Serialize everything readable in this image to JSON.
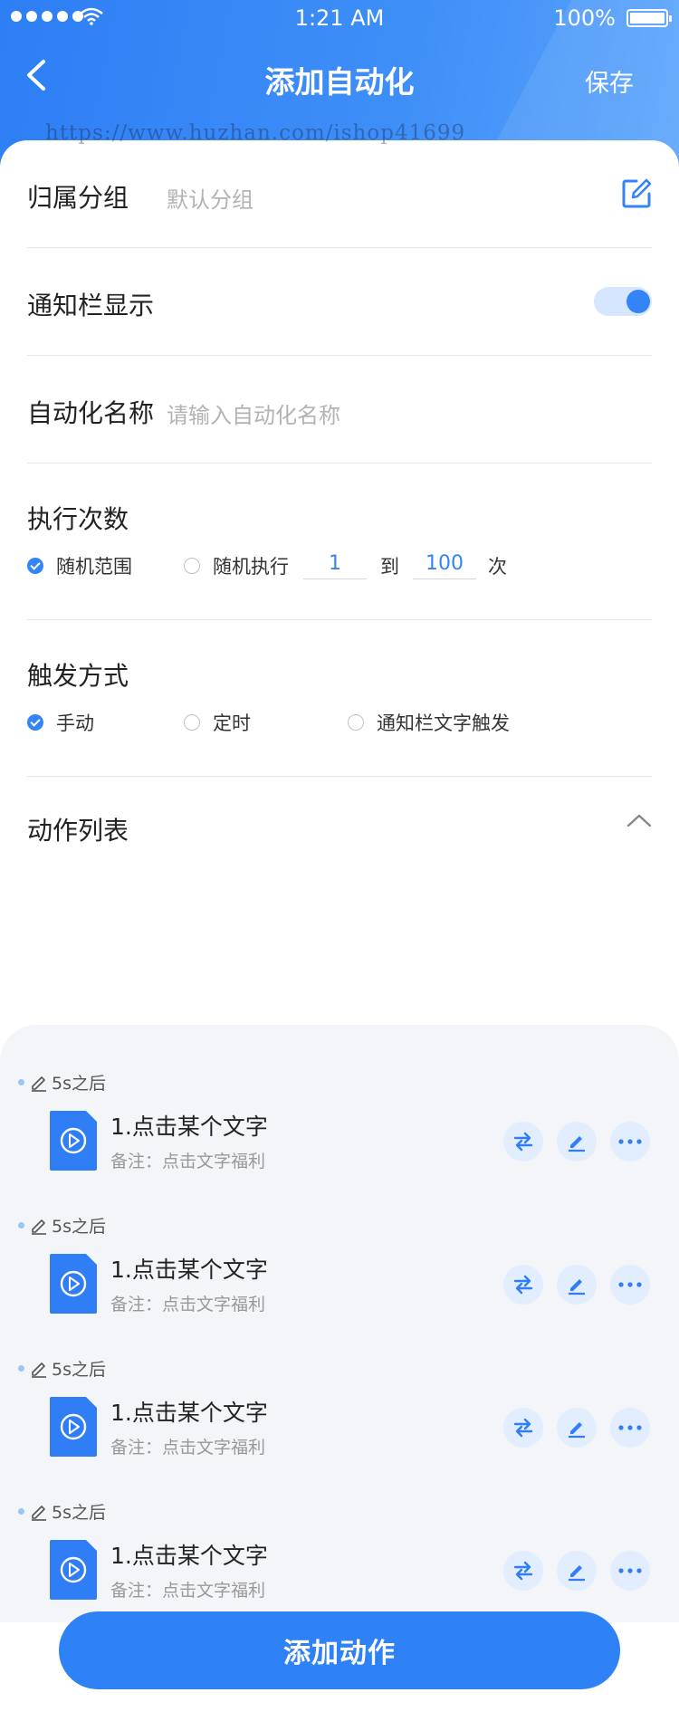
{
  "status_bar": {
    "time": "1:21 AM",
    "battery": "100%"
  },
  "nav": {
    "title": "添加自动化",
    "save_label": "保存"
  },
  "watermark": "https://www.huzhan.com/ishop41699",
  "form": {
    "group": {
      "label": "归属分组",
      "value": "默认分组"
    },
    "notify": {
      "label": "通知栏显示",
      "enabled": true
    },
    "name": {
      "label": "自动化名称",
      "placeholder": "请输入自动化名称"
    },
    "exec": {
      "label": "执行次数",
      "options": [
        {
          "label": "随机范围",
          "checked": true
        },
        {
          "label": "随机执行",
          "checked": false
        }
      ],
      "from": "1",
      "to_label": "到",
      "to": "100",
      "unit": "次"
    },
    "trigger": {
      "label": "触发方式",
      "options": [
        {
          "label": "手动",
          "checked": true
        },
        {
          "label": "定时",
          "checked": false
        },
        {
          "label": "通知栏文字触发",
          "checked": false
        }
      ]
    },
    "actions_label": "动作列表"
  },
  "actions": [
    {
      "delay": "5s之后",
      "title": "1.点击某个文字",
      "note": "备注：点击文字福利"
    },
    {
      "delay": "5s之后",
      "title": "1.点击某个文字",
      "note": "备注：点击文字福利"
    },
    {
      "delay": "5s之后",
      "title": "1.点击某个文字",
      "note": "备注：点击文字福利"
    },
    {
      "delay": "5s之后",
      "title": "1.点击某个文字",
      "note": "备注：点击文字福利"
    }
  ],
  "add_button": "添加动作",
  "colors": {
    "primary": "#2f82f6",
    "light_blue": "#e2edfd",
    "bg": "#f4f5f9"
  },
  "icons": [
    "back-arrow-icon",
    "edit-square-icon",
    "chevron-up-icon",
    "pencil-icon",
    "play-file-icon",
    "swap-icon",
    "edit-icon",
    "more-icon"
  ]
}
